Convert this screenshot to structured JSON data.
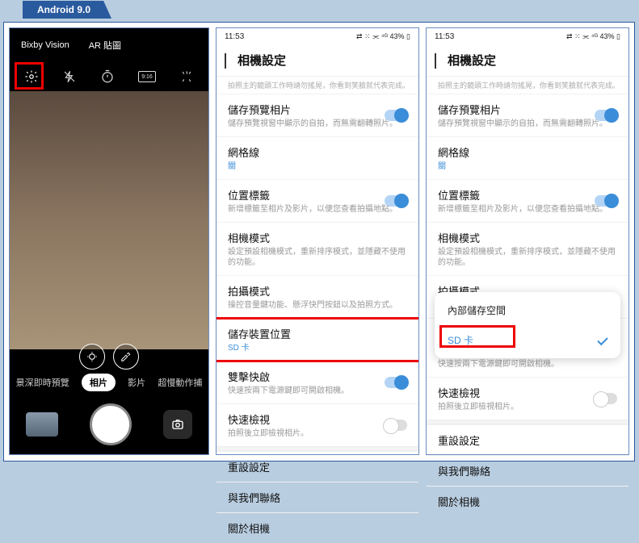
{
  "tab_label": "Android 9.0",
  "status": {
    "time": "11:53",
    "right": "⇄ ⁙ ⫘ ⁴ᴳ 43% ▯"
  },
  "header": {
    "title": "相機設定"
  },
  "top_note": "拍照主的鏡頭工作時請勿搖晃，你看到笑臉就代表完成。",
  "phone1": {
    "top_tabs": [
      "Bixby Vision",
      "AR 貼圖"
    ],
    "ratio": "9:16",
    "modes": {
      "scene": "景深即時預覽",
      "photo": "相片",
      "video": "影片",
      "slow": "超慢動作捕"
    }
  },
  "items": {
    "savePreview": {
      "t": "儲存預覽相片",
      "s": "儲存預覽視窗中顯示的自拍，而無需翻轉照片。"
    },
    "grid": {
      "t": "網格線",
      "s": "關"
    },
    "loc": {
      "t": "位置標籤",
      "s": "新增標籤至相片及影片，以便您查看拍攝地點。"
    },
    "camMode": {
      "t": "相機模式",
      "s": "設定預設相機模式，重新排序模式，並隱藏不使用的功能。"
    },
    "shoot": {
      "t": "拍攝模式",
      "s": "操控音量鍵功能、懸浮快門按鈕以及拍照方式。"
    },
    "storage": {
      "t": "儲存裝置位置",
      "s": "SD 卡"
    },
    "double": {
      "t": "雙擊快啟",
      "s": "快速按兩下電源鍵即可開啟相機。"
    },
    "quick": {
      "t": "快速檢視",
      "s": "拍照後立即檢視相片。"
    },
    "reset": {
      "t": "重設設定"
    },
    "contact": {
      "t": "與我們聯絡"
    },
    "about": {
      "t": "關於相機"
    }
  },
  "items3": {
    "internal": {
      "t": "內部儲存空間"
    },
    "sd": {
      "label": "SD 卡"
    },
    "double_partial": {
      "s": "快速按兩下電源鍵即可開啟相機。"
    }
  }
}
